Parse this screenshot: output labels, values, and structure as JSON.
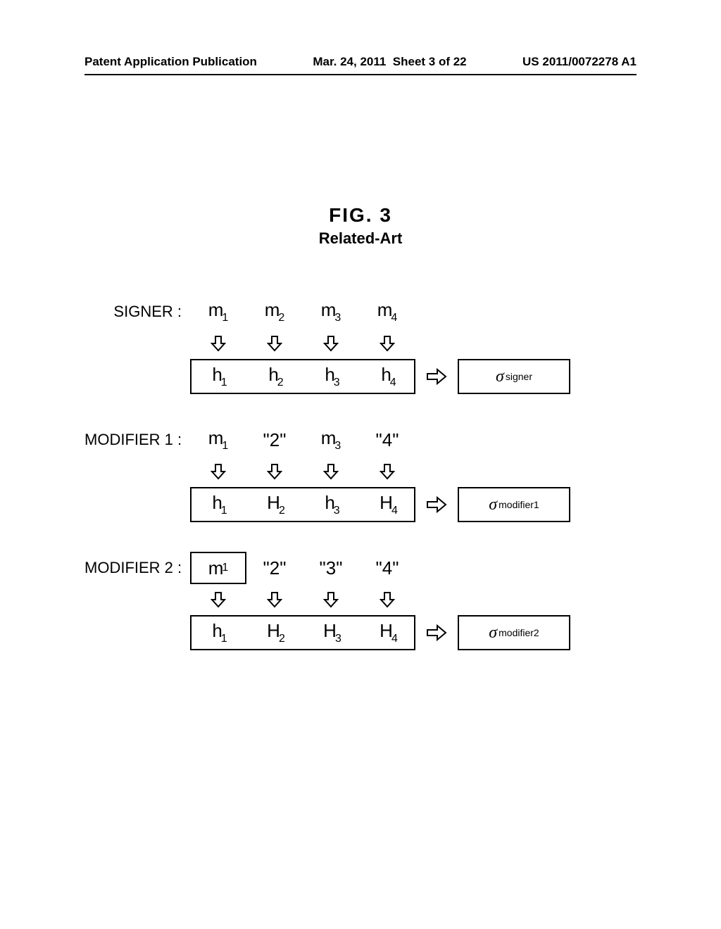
{
  "header": {
    "left": "Patent Application Publication",
    "center": "Mar. 24, 2011  Sheet 3 of 22",
    "right": "US 2011/0072278 A1"
  },
  "figure": {
    "num": "FIG. 3",
    "sub": "Related-Art"
  },
  "groups": {
    "signer": {
      "label": "SIGNER :",
      "m": [
        "m",
        "m",
        "m",
        "m"
      ],
      "msub": [
        "1",
        "2",
        "3",
        "4"
      ],
      "h": [
        "h",
        "h",
        "h",
        "h"
      ],
      "hsub": [
        "1",
        "2",
        "3",
        "4"
      ],
      "sigma": "σ",
      "sigmasub": "signer"
    },
    "mod1": {
      "label": "MODIFIER 1 :",
      "cells": [
        {
          "type": "m",
          "base": "m",
          "sub": "1"
        },
        {
          "type": "q",
          "val": "\"2\""
        },
        {
          "type": "m",
          "base": "m",
          "sub": "3"
        },
        {
          "type": "q",
          "val": "\"4\""
        }
      ],
      "h": [
        "h",
        "H",
        "h",
        "H"
      ],
      "hsub": [
        "1",
        "2",
        "3",
        "4"
      ],
      "sigma": "σ",
      "sigmasub": "modifier1"
    },
    "mod2": {
      "label": "MODIFIER 2 :",
      "cells": [
        {
          "type": "mbox",
          "base": "m",
          "sub": "1"
        },
        {
          "type": "q",
          "val": "\"2\""
        },
        {
          "type": "q",
          "val": "\"3\""
        },
        {
          "type": "q",
          "val": "\"4\""
        }
      ],
      "h": [
        "h",
        "H",
        "H",
        "H"
      ],
      "hsub": [
        "1",
        "2",
        "3",
        "4"
      ],
      "sigma": "σ",
      "sigmasub": "modifier2"
    }
  }
}
